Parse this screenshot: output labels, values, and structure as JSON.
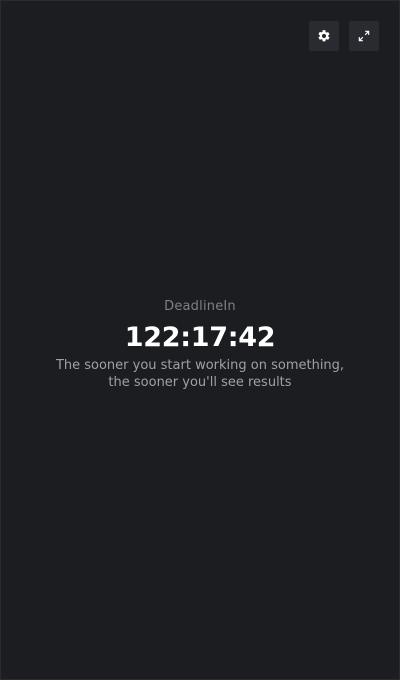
{
  "header": {
    "buttons": [
      {
        "name": "settings",
        "icon": "gear-icon"
      },
      {
        "name": "fullscreen",
        "icon": "expand-icon"
      }
    ]
  },
  "main": {
    "brand": "DeadlineIn",
    "timer": "122:17:42",
    "message": "The sooner you start working on something, the sooner you'll see results"
  },
  "colors": {
    "background": "#1c1d21",
    "button_bg": "#2a2b30",
    "text_primary": "#ffffff",
    "text_secondary": "#9fa0a6",
    "text_muted": "#7f8086"
  }
}
